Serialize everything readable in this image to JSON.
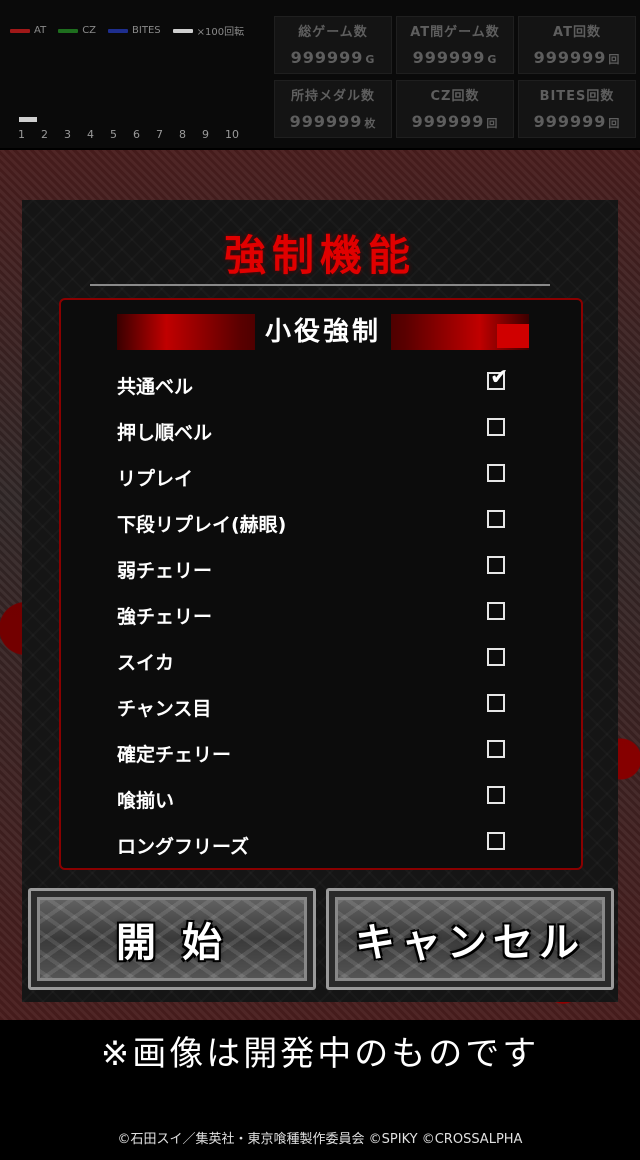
{
  "legend": [
    {
      "label": "AT",
      "color": "#a01818"
    },
    {
      "label": "CZ",
      "color": "#1e6e1e"
    },
    {
      "label": "BITES",
      "color": "#1e2e8e"
    },
    {
      "label": "×100回転",
      "color": "#cfcfcf"
    }
  ],
  "axis_ticks": [
    "1",
    "2",
    "3",
    "4",
    "5",
    "6",
    "7",
    "8",
    "9",
    "10"
  ],
  "stats": {
    "total_games": {
      "label": "総ゲーム数",
      "value": "999999",
      "unit": "G"
    },
    "at_games": {
      "label": "AT間ゲーム数",
      "value": "999999",
      "unit": "G"
    },
    "at_count": {
      "label": "AT回数",
      "value": "999999",
      "unit": "回"
    },
    "medals": {
      "label": "所持メダル数",
      "value": "999999",
      "unit": "枚"
    },
    "cz_count": {
      "label": "CZ回数",
      "value": "999999",
      "unit": "回"
    },
    "bites_count": {
      "label": "BITES回数",
      "value": "999999",
      "unit": "回"
    }
  },
  "dialog": {
    "title": "強制機能",
    "section_title": "小役強制",
    "options": [
      {
        "label": "共通ベル",
        "checked": true
      },
      {
        "label": "押し順ベル",
        "checked": false
      },
      {
        "label": "リプレイ",
        "checked": false
      },
      {
        "label": "下段リプレイ(赫眼)",
        "checked": false
      },
      {
        "label": "弱チェリー",
        "checked": false
      },
      {
        "label": "強チェリー",
        "checked": false
      },
      {
        "label": "スイカ",
        "checked": false
      },
      {
        "label": "チャンス目",
        "checked": false
      },
      {
        "label": "確定チェリー",
        "checked": false
      },
      {
        "label": "喰揃い",
        "checked": false
      },
      {
        "label": "ロングフリーズ",
        "checked": false
      }
    ],
    "start_label": "開 始",
    "cancel_label": "キャンセル"
  },
  "footer": {
    "notice": "※画像は開発中のものです",
    "copyright": "©石田スイ／集英社・東京喰種製作委員会 ©SPIKY ©CROSSALPHA"
  }
}
